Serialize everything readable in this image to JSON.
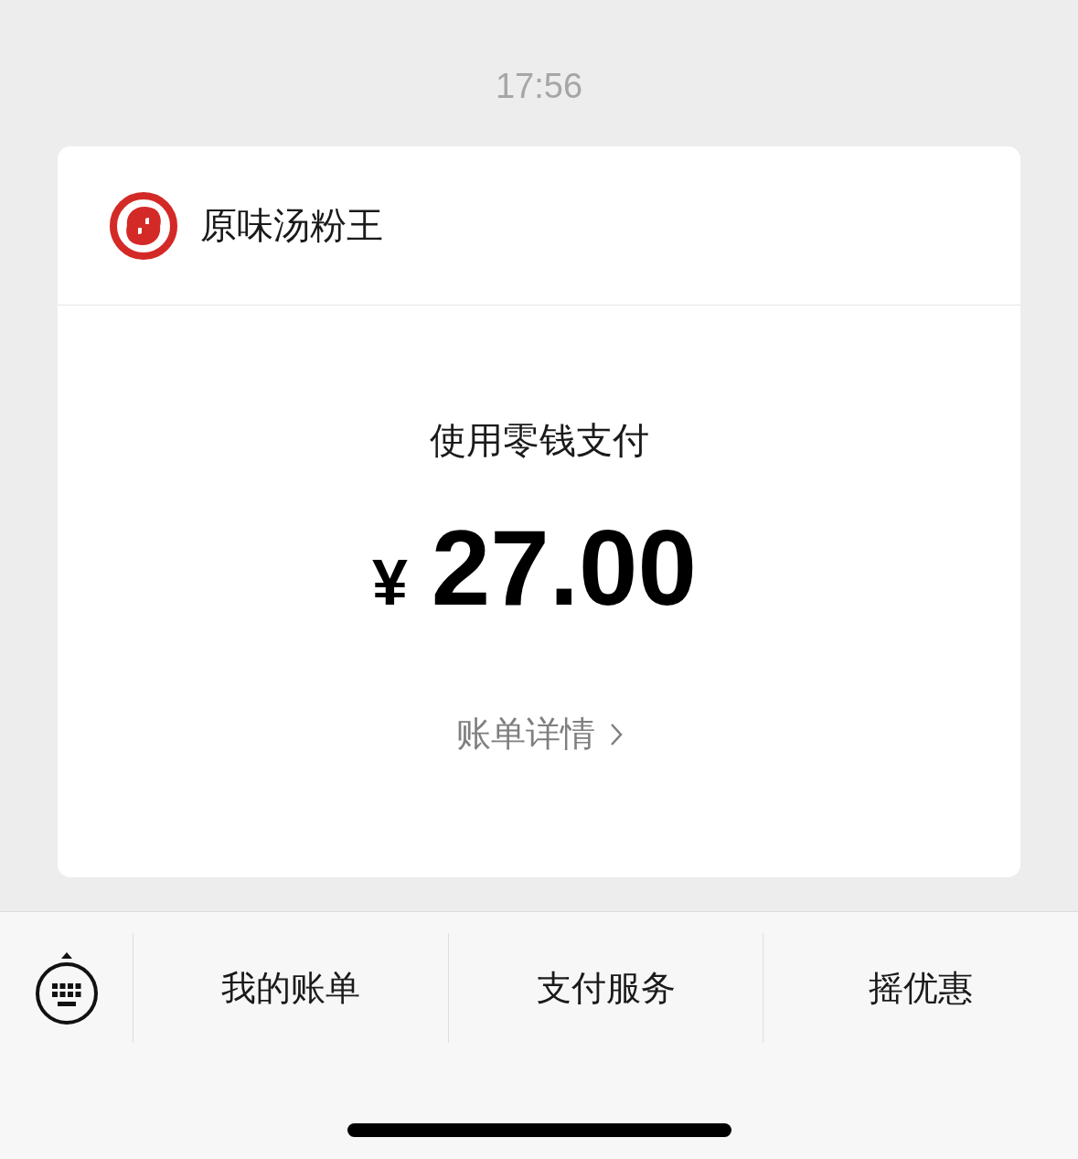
{
  "timestamp": "17:56",
  "card": {
    "merchant": "原味汤粉王",
    "method": "使用零钱支付",
    "currency": "¥",
    "amount": "27.00",
    "details_link": "账单详情"
  },
  "menu": [
    {
      "label": "我的账单"
    },
    {
      "label": "支付服务"
    },
    {
      "label": "摇优惠"
    }
  ]
}
